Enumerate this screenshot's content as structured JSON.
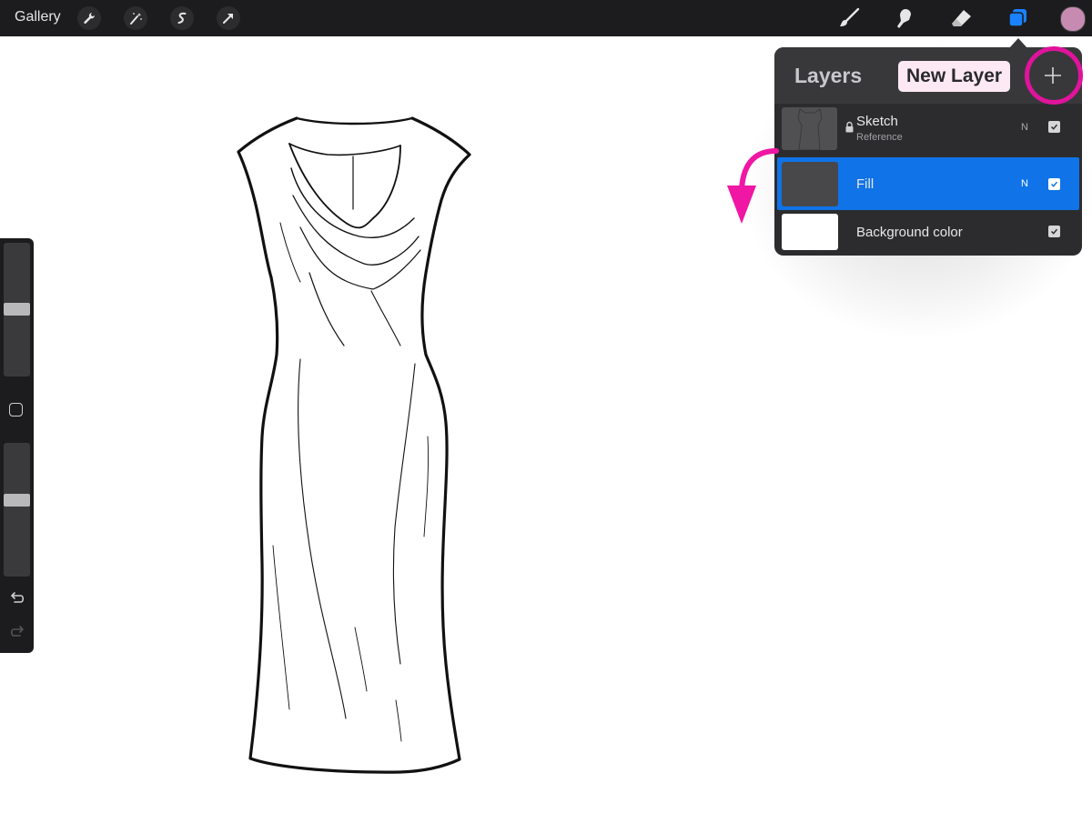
{
  "topbar": {
    "gallery_label": "Gallery",
    "left_tools": [
      "wrench-icon",
      "magic-wand-icon",
      "selection-icon",
      "transform-arrow-icon"
    ],
    "right_tools": [
      "brush-icon",
      "smudge-icon",
      "eraser-icon",
      "layers-icon"
    ],
    "current_color": "#c78bb2",
    "active_tool_color": "#1a82ff"
  },
  "sidebar": {
    "brush_size_slider": 0.5,
    "opacity_slider": 0.41,
    "icons": [
      "modify-square-icon",
      "undo-icon",
      "redo-icon"
    ]
  },
  "layers_panel": {
    "title": "Layers",
    "tooltip": "New Layer",
    "add_button_icon": "plus-icon",
    "highlight_color": "#e0139c",
    "layers": [
      {
        "name": "Sketch",
        "subtitle": "Reference",
        "blend": "N",
        "locked": true,
        "visible": true,
        "selected": false
      },
      {
        "name": "Fill",
        "blend": "N",
        "visible": true,
        "selected": true
      },
      {
        "name": "Background color",
        "visible": true,
        "selected": false
      }
    ],
    "selected_color": "#1073e8"
  },
  "annotation": {
    "arrow_color": "#ef17a3",
    "arrow_icon": "curved-arrow-down-icon"
  },
  "canvas": {
    "subject": "dress-line-drawing"
  }
}
